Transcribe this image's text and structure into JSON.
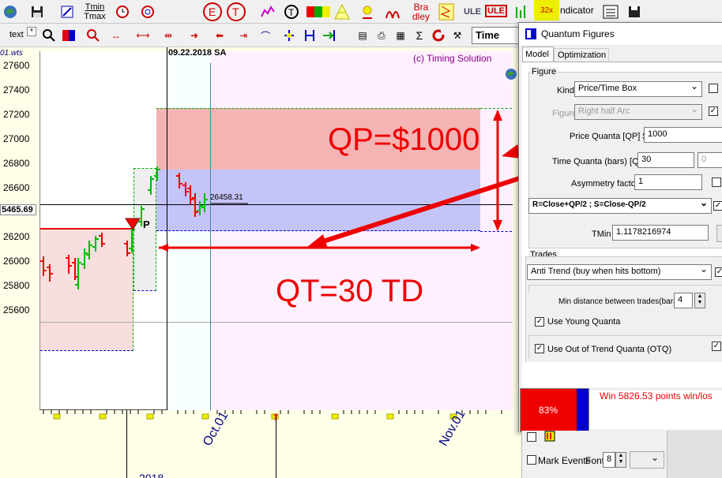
{
  "toolbar1": {
    "tmin_label": "Tmin",
    "tmax_label": "Tmax",
    "bradley_label_1": "Bra",
    "bradley_label_2": "dley",
    "ule_label": "ULE",
    "ule_boxed_label": "ULE",
    "x32_label": "32x",
    "indicator_label": "ndicator"
  },
  "toolbar2": {
    "text_label": "text",
    "time_select": "Time"
  },
  "chart": {
    "corner_label": "01.wts",
    "date_label": "09.22.2018 SA",
    "copyright": "(c) Timing Solution",
    "current_price": "5465.69",
    "price_annotation": "26458.31",
    "marker_label": "P",
    "qp_annotation": "QP=$1000",
    "qt_annotation": "QT=30 TD",
    "y_ticks": [
      "27600",
      "27400",
      "27200",
      "27000",
      "26800",
      "26600",
      "26400",
      "26200",
      "26000",
      "25800",
      "25600"
    ],
    "x_labels": [
      "Oct.01",
      "Nov.01"
    ],
    "bottom_label": "2018"
  },
  "dialog": {
    "title": "Quantum Figures",
    "tabs": [
      "Model",
      "Optimization"
    ],
    "figure_group": "Figure",
    "kind_label": "Kind",
    "kind_value": "Price/Time Box",
    "figure_label": "Figure",
    "figure_value": "Right half Arc",
    "pq_label": "Price Quanta [QP] $",
    "pq_value": "1000",
    "tq_label": "Time Quanta (bars) [QT]",
    "tq_value": "30",
    "tq_value2": "0",
    "asym_label": "Asymmetry factor",
    "asym_value": "1",
    "rs_value": "R=Close+QP/2 ;  S=Close-QP/2",
    "tmin_label": "TMin",
    "tmin_value": "1.1178216974",
    "trades_group": "Trades",
    "trades_value": "Anti Trend (buy when hits bottom)",
    "min_dist_label": "Min distance between trades(bars)",
    "min_dist_value": "4",
    "young_label": "Use Young Quanta",
    "otq_label": "Use Out of Trend Quanta (OTQ)",
    "progress_pct": "83%",
    "progress_value": 0.83,
    "win_text": "Win 5826.53  points  win/los"
  },
  "bottom_panel": {
    "mark_events_label": "Mark Events",
    "font_label": "Font",
    "font_value": "8"
  }
}
